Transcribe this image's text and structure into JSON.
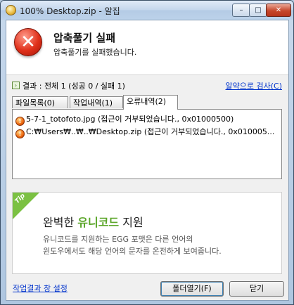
{
  "window": {
    "title": "100% Desktop.zip - 알집"
  },
  "header": {
    "title": "압축풀기 실패",
    "subtitle": "압축풀기를 실패했습니다."
  },
  "result": {
    "summary": "결과 : 전체 1 (성공 0 / 실패 1)",
    "search_link": "알약으로 검사(C)"
  },
  "tabs": [
    {
      "label": "파일목록(0)"
    },
    {
      "label": "작업내역(1)"
    },
    {
      "label": "오류내역(2)",
      "active": true
    }
  ],
  "errors": [
    {
      "text": "5-7-1_totofoto.jpg (접근이 거부되었습니다., 0x01000500)"
    },
    {
      "text": "C:₩Users₩..₩..₩Desktop.zip (접근이 거부되었습니다., 0x010005..."
    }
  ],
  "tip": {
    "badge": "Tip",
    "title_pre": "완벽한 ",
    "title_highlight": "유니코드",
    "title_post": " 지원",
    "line1": "유니코드를 지원하는 EGG 포맷은 다른 언어의",
    "line2": "윈도우에서도 해당 언어의 문자를 온전하게 보여줍니다."
  },
  "footer": {
    "settings_link": "작업결과 창 설정",
    "open_folder": "폴더열기(F)",
    "close": "닫기"
  },
  "colors": {
    "accent_green": "#5aa528",
    "link_blue": "#0033cc",
    "error_red": "#e0301a"
  }
}
